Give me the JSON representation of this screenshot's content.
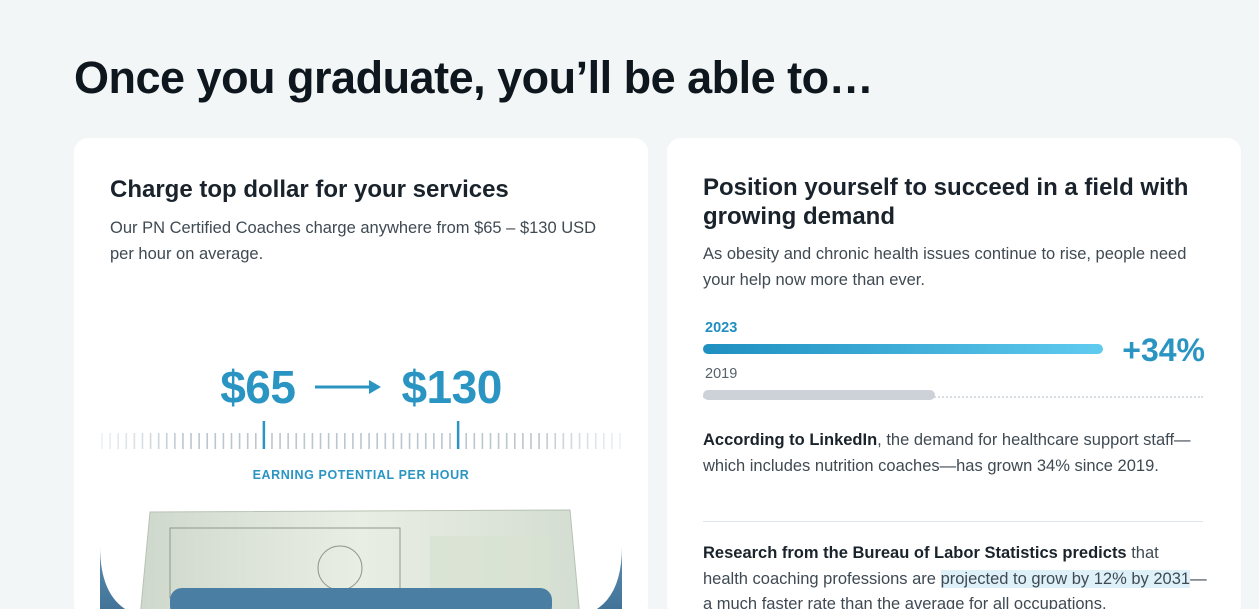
{
  "page": {
    "title": "Once you graduate, you’ll be able to…"
  },
  "card_left": {
    "heading": "Charge top dollar for your services",
    "text": "Our PN Certified Coaches charge anywhere from $65 – $130 USD per hour on average.",
    "price_low": "$65",
    "price_high": "$130",
    "ruler_label": "EARNING POTENTIAL PER HOUR"
  },
  "card_right": {
    "heading": "Position yourself to succeed in a field with growing demand",
    "text": "As obesity and chronic health issues continue to rise, people need your help now more than ever.",
    "growth": {
      "year_current": "2023",
      "year_previous": "2019",
      "percent_label": "+34%",
      "bar_current_fraction": 1.0,
      "bar_previous_fraction": 0.58
    },
    "stat_1": {
      "bold": "According to LinkedIn",
      "rest": ", the demand for healthcare support staff—which includes nutrition coaches—has grown 34% since 2019."
    },
    "stat_2": {
      "bold": "Research from the Bureau of Labor Statistics predicts",
      "pre": " that health coaching professions are ",
      "highlight": "projected to grow by 12% by 2031",
      "rest": "—a much faster rate than the average for all occupations."
    }
  },
  "colors": {
    "accent": "#2a95c2",
    "background": "#f3f6f7",
    "card": "#ffffff"
  }
}
